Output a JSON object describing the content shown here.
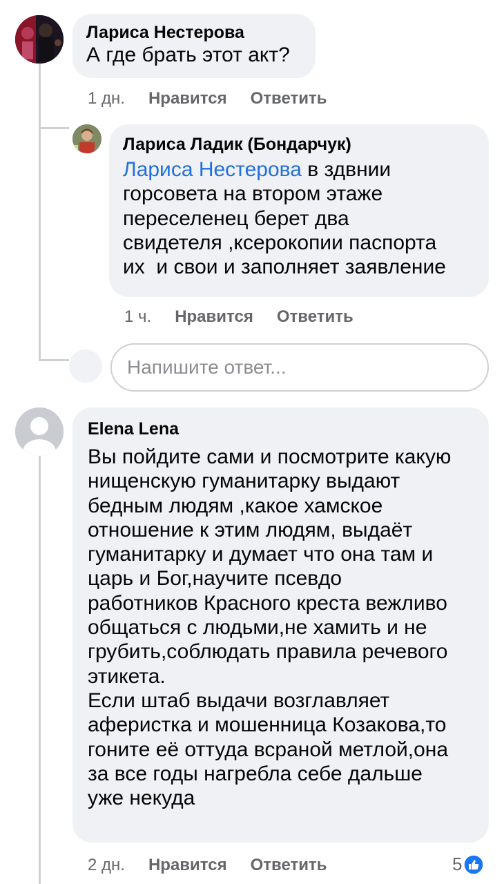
{
  "comments": [
    {
      "author": "Лариса Нестерова",
      "text": "А где брать этот акт?",
      "time": "1 дн.",
      "like_label": "Нравится",
      "reply_label": "Ответить"
    },
    {
      "author": "Лариса Ладик (Бондарчук)",
      "mention": "Лариса Нестерова",
      "text_lines": [
        " в здвнии",
        "горсовета на втором этаже",
        "переселенец берет два",
        "свидетеля ,ксерокопии паспорта",
        "их  и свои и заполняет заявление"
      ],
      "time": "1 ч.",
      "like_label": "Нравится",
      "reply_label": "Ответить"
    },
    {
      "author": "Elena Lena",
      "text_lines": [
        "Вы пойдите сами и посмотрите какую",
        "нищенскую гуманитарку выдают",
        "бедным людям ,какое хамское",
        "отношение к этим людям, выдаёт",
        "гуманитарку и думает что она там и",
        "царь и Бог,научите псевдо",
        "работников Красного креста вежливо",
        "общаться с людьми,не хамить и не",
        "грубить,соблюдать правила речевого",
        "этикета.",
        "Если штаб выдачи возглавляет",
        "аферистка и мошенница Козакова,то",
        "гоните её оттуда всраной метлой,она",
        "за все годы нагребла себе дальше",
        "уже некуда"
      ],
      "time": "2 дн.",
      "like_label": "Нравится",
      "reply_label": "Ответить",
      "reaction_count": "5",
      "reaction_icon": "like-reaction-icon"
    }
  ],
  "reply_input": {
    "placeholder": "Напишите ответ..."
  },
  "colors": {
    "bubble": "#eff1f4",
    "mention": "#216fdb",
    "meta": "#65676b",
    "like_blue": "#1877f2"
  }
}
